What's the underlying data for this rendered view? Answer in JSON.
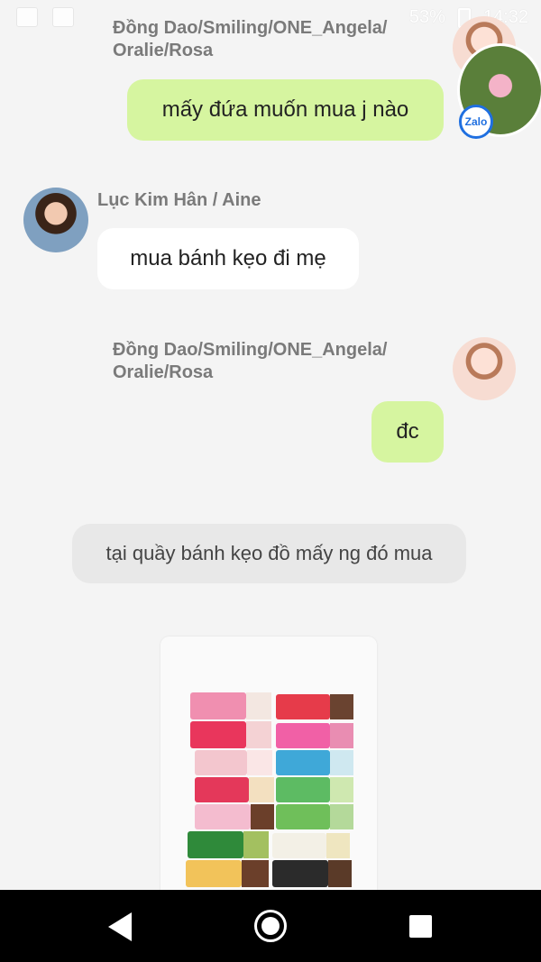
{
  "status_bar": {
    "battery": "53%",
    "time": "14:32"
  },
  "messages": [
    {
      "sender": "Đồng Dao/Smiling/ONE_Angela/\nOralie/Rosa",
      "text": "mấy đứa muốn mua j nào"
    },
    {
      "sender": "Lục Kim Hân / Aine",
      "text": "mua bánh kẹo đi mẹ"
    },
    {
      "sender": "Đồng Dao/Smiling/ONE_Angela/\nOralie/Rosa",
      "text": "đc"
    }
  ],
  "system_message": "tại quầy bánh kẹo đồ mấy ng đó mua",
  "zalo_badge": "Zalo",
  "colors": {
    "outgoing_bubble": "#d6f5a0",
    "incoming_bubble": "#ffffff",
    "background": "#f4f4f4"
  }
}
